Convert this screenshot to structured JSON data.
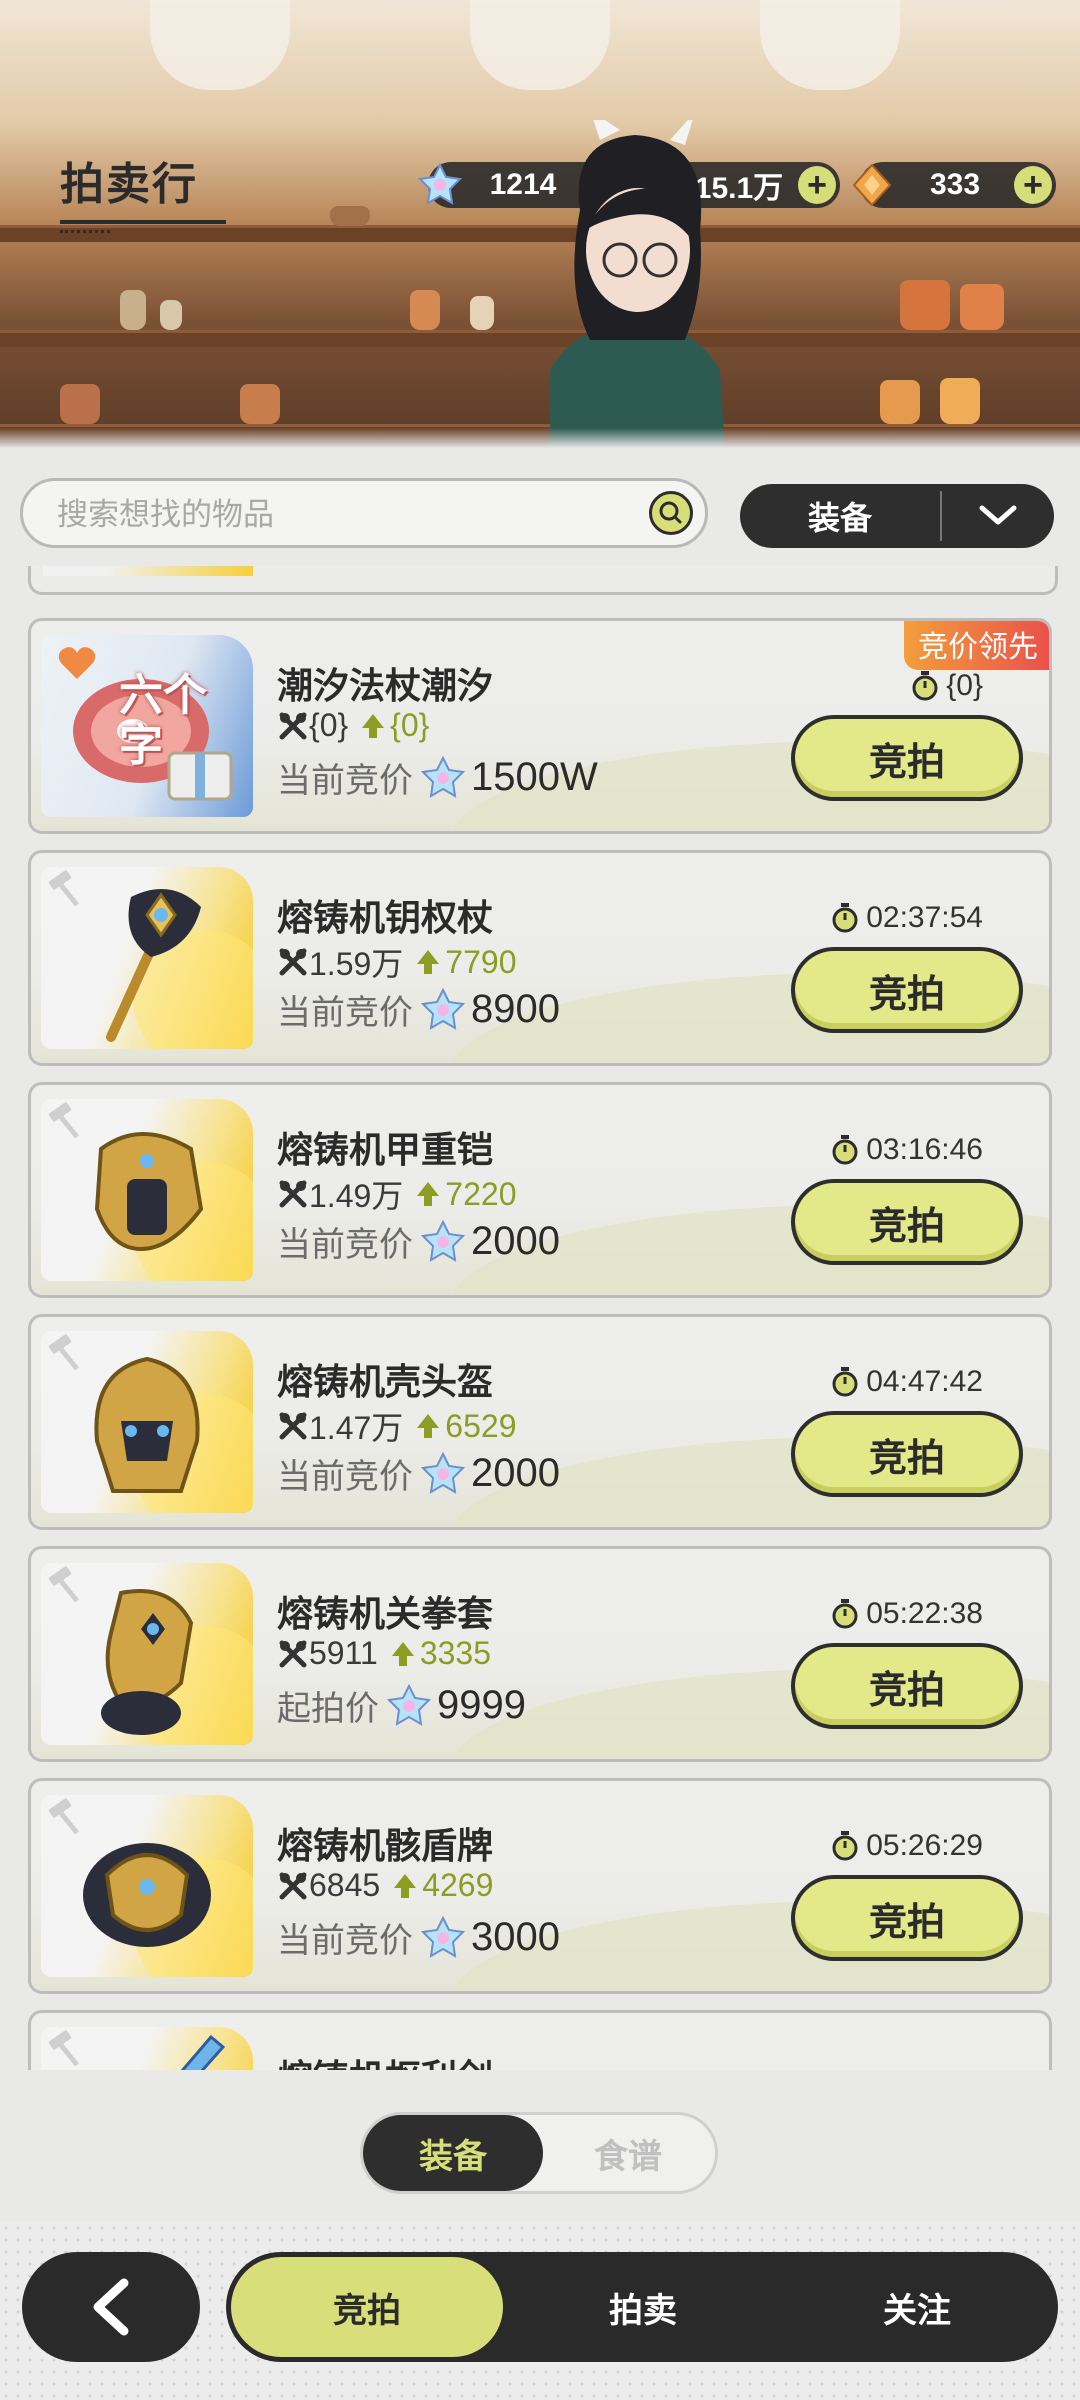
{
  "header": {
    "title": "拍卖行",
    "currencies": [
      {
        "icon": "crystal-icon",
        "value": "1214"
      },
      {
        "icon": "gold-coin-icon",
        "value": "15.1万"
      },
      {
        "icon": "amber-gem-icon",
        "value": "333"
      }
    ],
    "plus_label": "+"
  },
  "search": {
    "placeholder": "搜索想找的物品",
    "value": ""
  },
  "category_dropdown": {
    "selected": "装备"
  },
  "items": [
    {
      "name": "潮汐法杖潮汐",
      "stat": "{0}",
      "stat_up": "{0}",
      "price_label": "当前竞价",
      "price": "1500W",
      "timer": "{0}",
      "button": "竞拍",
      "badge": "竞价领先",
      "thumb_text": "六个字"
    },
    {
      "name": "熔铸机钥权杖",
      "stat": "1.59万",
      "stat_up": "7790",
      "price_label": "当前竞价",
      "price": "8900",
      "timer": "02:37:54",
      "button": "竞拍"
    },
    {
      "name": "熔铸机甲重铠",
      "stat": "1.49万",
      "stat_up": "7220",
      "price_label": "当前竞价",
      "price": "2000",
      "timer": "03:16:46",
      "button": "竞拍"
    },
    {
      "name": "熔铸机壳头盔",
      "stat": "1.47万",
      "stat_up": "6529",
      "price_label": "当前竞价",
      "price": "2000",
      "timer": "04:47:42",
      "button": "竞拍"
    },
    {
      "name": "熔铸机关拳套",
      "stat": "5911",
      "stat_up": "3335",
      "price_label": "起拍价",
      "price": "9999",
      "timer": "05:22:38",
      "button": "竞拍"
    },
    {
      "name": "熔铸机骸盾牌",
      "stat": "6845",
      "stat_up": "4269",
      "price_label": "当前竞价",
      "price": "3000",
      "timer": "05:26:29",
      "button": "竞拍"
    },
    {
      "name": "熔铸机枢利剑",
      "stat": "",
      "stat_up": "",
      "price_label": "",
      "price": "",
      "timer": "",
      "button": ""
    }
  ],
  "segment": {
    "active": "装备",
    "inactive": "食谱"
  },
  "bottom_nav": {
    "tabs": [
      "竞拍",
      "拍卖",
      "关注"
    ],
    "active_index": 0
  },
  "colors": {
    "accent": "#d8de79",
    "dark": "#2a2a2a",
    "stat_up": "#8c9d23",
    "lead_badge": "#e9504c"
  }
}
